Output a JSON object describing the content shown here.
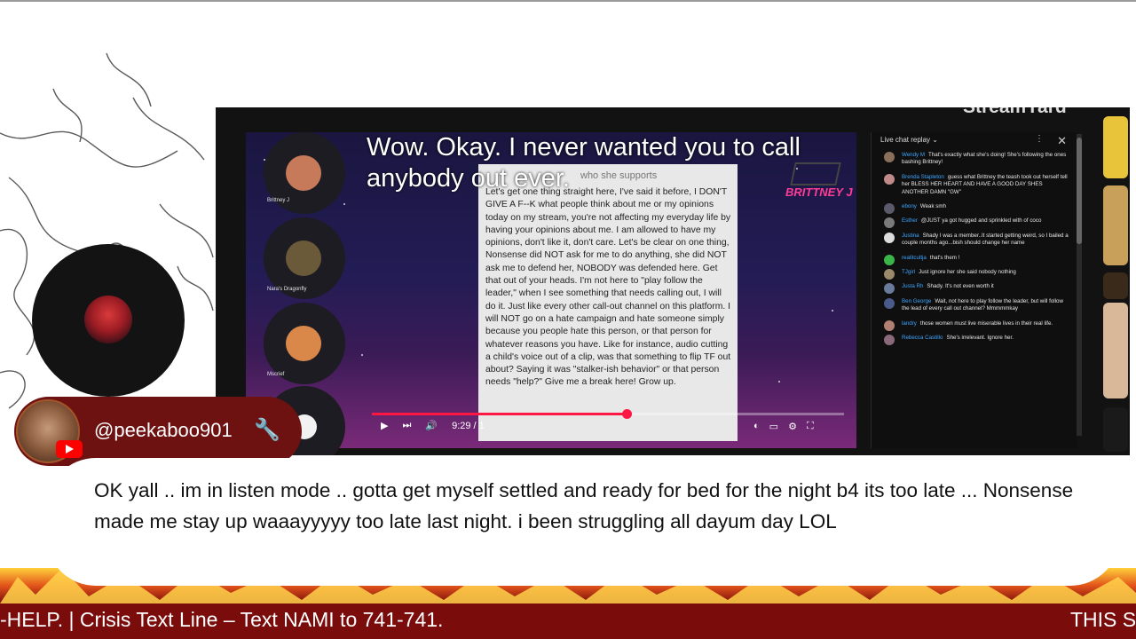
{
  "colors": {
    "ticker_bg": "#7a0c0c",
    "namebar_bg": "#6e1111",
    "accent_red": "#ff1744",
    "chat_name_blue": "#3ea6ff",
    "brittney_pink": "#ff3c96"
  },
  "video": {
    "watermark": "StreamYard",
    "caption": "Wow. Okay. I never wanted you to call anybody out ever.",
    "brittney_label": "BRITTNEY J",
    "participants": [
      {
        "name": "Brittney J",
        "avatar_color": "#c77a5a"
      },
      {
        "name": "Nara's Dragonfly",
        "avatar_color": "#6b5a3a"
      },
      {
        "name": "Mscrief",
        "avatar_color": "#d9884a"
      }
    ],
    "text_card": {
      "header": "who she supports",
      "body": "Let's get one thing straight here, I've said it before, I DON'T GIVE A F--K what people think about me or my opinions today on my stream, you're not affecting my everyday life by having your opinions about me. I am allowed to have my opinions, don't like it, don't care. Let's be clear on one thing, Nonsense did NOT ask for me to do anything, she did NOT ask me to defend her, NOBODY was defended here. Get that out of your heads. I'm not here to \"play follow the leader,\" when I see something that needs calling out, I will do it. Just like every other call-out channel on this platform. I will NOT go on a hate campaign and hate someone simply because you people hate this person, or that person for whatever reasons you have. Like for instance, audio cutting a child's voice out of a clip, was that something to flip TF out about? Saying it was \"stalker-ish behavior\" or that person needs \"help?\" Give me a break here! Grow up."
    },
    "player": {
      "time": "9:29 / 1",
      "progress": 0.54
    },
    "chat": {
      "title": "Live chat replay",
      "messages": [
        {
          "name": "Wendy M",
          "text": "That's exactly what she's doing! She's following the ones bashing Brittney!"
        },
        {
          "name": "Brenda Stapleton",
          "text": "guess what Brittney the teash took out herself tell her BLESS HER HEART AND HAVE A GOOD DAY SHES ANOTHER DAMN \"GW\""
        },
        {
          "name": "ebony",
          "text": "Weak smh"
        },
        {
          "name": "Esther",
          "text": "@JUST ya got hugged and sprinkled with of coco"
        },
        {
          "name": "Justina",
          "text": "Shady I was a member..It started getting weird, so I bailed a couple months ago...bish should change her name"
        },
        {
          "name": "realitcultja",
          "text": "that's them !"
        },
        {
          "name": "TJgirl",
          "text": "Just ignore her she said nobody nothing"
        },
        {
          "name": "Justa Rh",
          "text": "Shady. It's not even worth it"
        },
        {
          "name": "Ben George",
          "text": "Wait, not here to play follow the leader, but will follow the lead of every call out channel? Mmmmmkay"
        },
        {
          "name": "landry",
          "text": "those women must live miserable lives in their real life."
        },
        {
          "name": "Rebecca Castillo",
          "text": "She's irrelevant. Ignore her."
        }
      ]
    }
  },
  "commenter": {
    "username": "@peekaboo901",
    "message": "OK yall .. im in listen mode .. gotta get myself settled and ready for bed for the night b4 its too late ... Nonsense made me stay up waaayyyyy too late last night. i been struggling all dayum day LOL",
    "icons": [
      "youtube-icon",
      "wrench-icon"
    ]
  },
  "ticker": {
    "text_left": "-HELP. | Crisis Text Line – Text NAMI to 741-741.",
    "text_right": "THIS S"
  }
}
